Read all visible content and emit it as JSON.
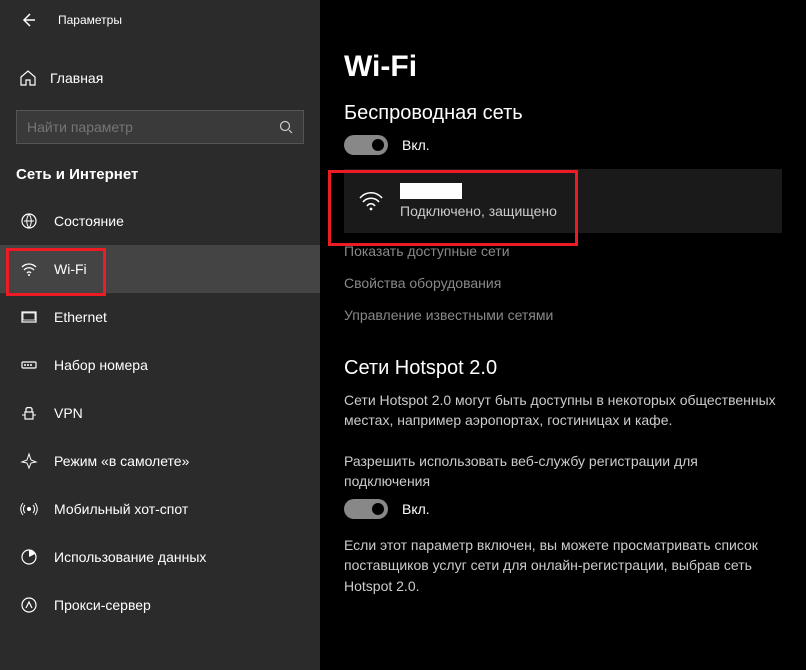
{
  "header": {
    "title": "Параметры"
  },
  "sidebar": {
    "home": "Главная",
    "search_placeholder": "Найти параметр",
    "category": "Сеть и Интернет",
    "items": [
      {
        "id": "status",
        "label": "Состояние",
        "icon": "status"
      },
      {
        "id": "wifi",
        "label": "Wi-Fi",
        "icon": "wifi",
        "selected": true
      },
      {
        "id": "ethernet",
        "label": "Ethernet",
        "icon": "ethernet"
      },
      {
        "id": "dialup",
        "label": "Набор номера",
        "icon": "dialup"
      },
      {
        "id": "vpn",
        "label": "VPN",
        "icon": "vpn"
      },
      {
        "id": "airplane",
        "label": "Режим «в самолете»",
        "icon": "airplane"
      },
      {
        "id": "hotspot",
        "label": "Мобильный хот-спот",
        "icon": "hotspot"
      },
      {
        "id": "datausage",
        "label": "Использование данных",
        "icon": "data"
      },
      {
        "id": "proxy",
        "label": "Прокси-сервер",
        "icon": "proxy"
      }
    ]
  },
  "main": {
    "title": "Wi-Fi",
    "wireless_section": "Беспроводная сеть",
    "toggle_on_label": "Вкл.",
    "network": {
      "status": "Подключено, защищено"
    },
    "links": {
      "show_networks": "Показать доступные сети",
      "hardware_props": "Свойства оборудования",
      "manage_known": "Управление известными сетями"
    },
    "hotspot2": {
      "title": "Сети Hotspot 2.0",
      "desc": "Сети Hotspot 2.0 могут быть доступны в некоторых общественных местах, например аэропортах, гостиницах и кафе.",
      "allow_label": "Разрешить использовать веб-службу регистрации для подключения",
      "toggle_label": "Вкл.",
      "footer": "Если этот параметр включен, вы можете просматривать список поставщиков услуг сети для онлайн-регистрации, выбрав сеть Hotspot 2.0."
    }
  }
}
